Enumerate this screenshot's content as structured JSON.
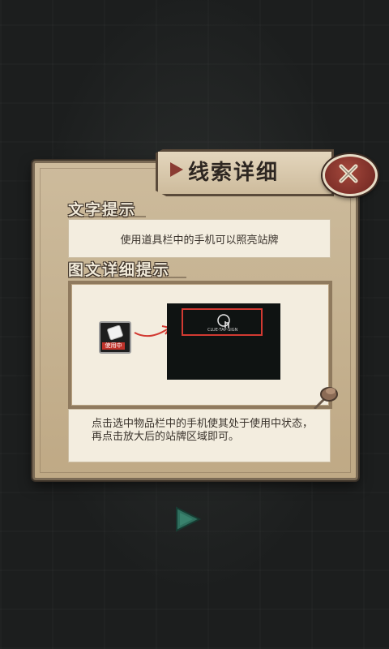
{
  "window": {
    "title": "线索详细"
  },
  "sections": {
    "text_hint_label": "文字提示",
    "text_hint": "使用道具栏中的手机可以照亮站牌",
    "image_hint_label": "图文详细提示",
    "image_hint": {
      "item_tag": "使用中",
      "mini_caption": "CLUE·TAP·SIGN"
    },
    "description": "点击选中物品栏中的手机使其处于使用中状态，再点击放大后的站牌区域即可。"
  },
  "icons": {
    "close": "close-icon",
    "phone": "phone-icon",
    "tap": "tap-icon",
    "pin": "pushpin-icon",
    "next": "next-arrow-icon"
  },
  "colors": {
    "panel": "#c6b392",
    "accent_red": "#8a3b32",
    "highlight_red": "#d23a32",
    "next_arrow": "#2f6f5e"
  }
}
